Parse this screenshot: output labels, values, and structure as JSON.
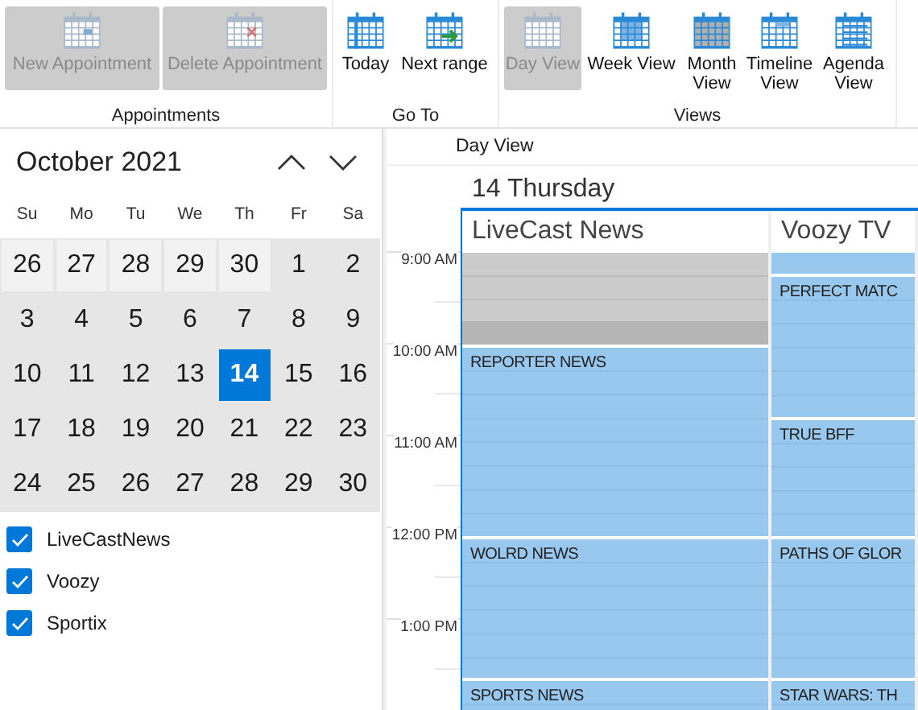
{
  "ribbon": {
    "groups": [
      {
        "label": "Appointments",
        "buttons": [
          {
            "label": "New Appointment",
            "kind": "new",
            "disabled": true
          },
          {
            "label": "Delete Appointment",
            "kind": "delete",
            "disabled": true
          }
        ]
      },
      {
        "label": "Go To",
        "buttons": [
          {
            "label": "Today",
            "kind": "today",
            "disabled": false
          },
          {
            "label": "Next range",
            "kind": "next",
            "disabled": false
          }
        ]
      },
      {
        "label": "Views",
        "buttons": [
          {
            "label": "Day View",
            "kind": "day",
            "selected": true
          },
          {
            "label": "Week View",
            "kind": "week",
            "selected": false
          },
          {
            "label": "Month View",
            "kind": "month",
            "selected": false
          },
          {
            "label": "Timeline View",
            "kind": "timeline",
            "selected": false
          },
          {
            "label": "Agenda View",
            "kind": "agenda",
            "selected": false
          }
        ]
      }
    ]
  },
  "calendar": {
    "title": "October 2021",
    "weekdays": [
      "Su",
      "Mo",
      "Tu",
      "We",
      "Th",
      "Fr",
      "Sa"
    ],
    "weeks": [
      [
        {
          "label": "26",
          "other_month": true,
          "selected": false
        },
        {
          "label": "27",
          "other_month": true,
          "selected": false
        },
        {
          "label": "28",
          "other_month": true,
          "selected": false
        },
        {
          "label": "29",
          "other_month": true,
          "selected": false
        },
        {
          "label": "30",
          "other_month": true,
          "selected": false
        },
        {
          "label": "1",
          "other_month": false,
          "selected": false
        },
        {
          "label": "2",
          "other_month": false,
          "selected": false
        }
      ],
      [
        {
          "label": "3",
          "other_month": false,
          "selected": false
        },
        {
          "label": "4",
          "other_month": false,
          "selected": false
        },
        {
          "label": "5",
          "other_month": false,
          "selected": false
        },
        {
          "label": "6",
          "other_month": false,
          "selected": false
        },
        {
          "label": "7",
          "other_month": false,
          "selected": false
        },
        {
          "label": "8",
          "other_month": false,
          "selected": false
        },
        {
          "label": "9",
          "other_month": false,
          "selected": false
        }
      ],
      [
        {
          "label": "10",
          "other_month": false,
          "selected": false
        },
        {
          "label": "11",
          "other_month": false,
          "selected": false
        },
        {
          "label": "12",
          "other_month": false,
          "selected": false
        },
        {
          "label": "13",
          "other_month": false,
          "selected": false
        },
        {
          "label": "14",
          "other_month": false,
          "selected": true
        },
        {
          "label": "15",
          "other_month": false,
          "selected": false
        },
        {
          "label": "16",
          "other_month": false,
          "selected": false
        }
      ],
      [
        {
          "label": "17",
          "other_month": false,
          "selected": false
        },
        {
          "label": "18",
          "other_month": false,
          "selected": false
        },
        {
          "label": "19",
          "other_month": false,
          "selected": false
        },
        {
          "label": "20",
          "other_month": false,
          "selected": false
        },
        {
          "label": "21",
          "other_month": false,
          "selected": false
        },
        {
          "label": "22",
          "other_month": false,
          "selected": false
        },
        {
          "label": "23",
          "other_month": false,
          "selected": false
        }
      ],
      [
        {
          "label": "24",
          "other_month": false,
          "selected": false
        },
        {
          "label": "25",
          "other_month": false,
          "selected": false
        },
        {
          "label": "26",
          "other_month": false,
          "selected": false
        },
        {
          "label": "27",
          "other_month": false,
          "selected": false
        },
        {
          "label": "28",
          "other_month": false,
          "selected": false
        },
        {
          "label": "29",
          "other_month": false,
          "selected": false
        },
        {
          "label": "30",
          "other_month": false,
          "selected": false
        }
      ]
    ]
  },
  "filters": [
    {
      "label": "LiveCastNews",
      "checked": true
    },
    {
      "label": "Voozy",
      "checked": true
    },
    {
      "label": "Sportix",
      "checked": true
    }
  ],
  "schedule": {
    "view_label": "Day View",
    "date": "14 Thursday",
    "times": [
      "9:00 AM",
      "10:00 AM",
      "11:00 AM",
      "12:00 PM",
      "1:00 PM"
    ],
    "resources": [
      {
        "name": "LiveCast News",
        "events": [
          {
            "kind": "blocked"
          },
          {
            "kind": "event",
            "title": "REPORTER NEWS"
          },
          {
            "kind": "event",
            "title": "WOLRD NEWS"
          },
          {
            "kind": "event",
            "title": "SPORTS NEWS"
          }
        ]
      },
      {
        "name": "Voozy TV",
        "events": [
          {
            "kind": "event"
          },
          {
            "kind": "event",
            "title": "PERFECT MATC"
          },
          {
            "kind": "event",
            "title": "TRUE BFF"
          },
          {
            "kind": "event",
            "title": "PATHS OF GLOR"
          },
          {
            "kind": "event",
            "title": "STAR WARS: TH"
          }
        ]
      }
    ]
  }
}
